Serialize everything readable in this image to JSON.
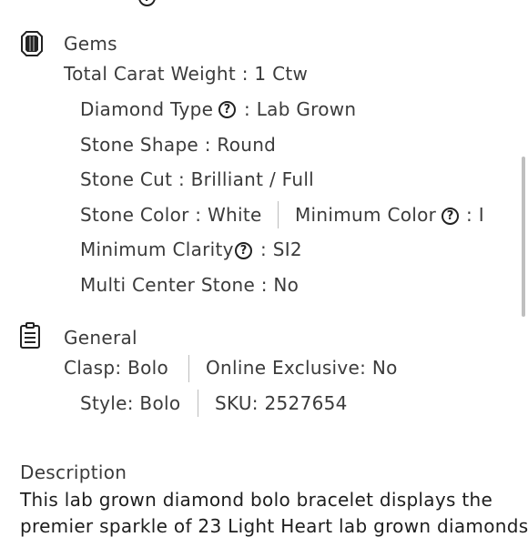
{
  "gems": {
    "heading": "Gems",
    "icon": "gem-icon",
    "total_carat": "Total Carat Weight : 1 Ctw",
    "diamond_type_label": "Diamond Type",
    "diamond_type_value": ": Lab Grown",
    "stone_shape": "Stone Shape : Round",
    "stone_cut": "Stone Cut : Brilliant / Full",
    "stone_color": "Stone Color : White",
    "minimum_color_label": "Minimum Color",
    "minimum_color_value": ": I",
    "minimum_clarity_label": "Minimum Clarity",
    "minimum_clarity_value": ": SI2",
    "multi_center": "Multi Center Stone : No"
  },
  "general": {
    "heading": "General",
    "icon": "clipboard-list-icon",
    "clasp": "Clasp: Bolo",
    "online_exclusive": "Online Exclusive: No",
    "style": "Style: Bolo",
    "sku": "SKU: 2527654"
  },
  "description": {
    "heading": "Description",
    "line1": "This lab grown diamond bolo bracelet displays the",
    "line2": "premier sparkle of 23 Light Heart lab grown diamonds"
  },
  "help_glyph": "?"
}
